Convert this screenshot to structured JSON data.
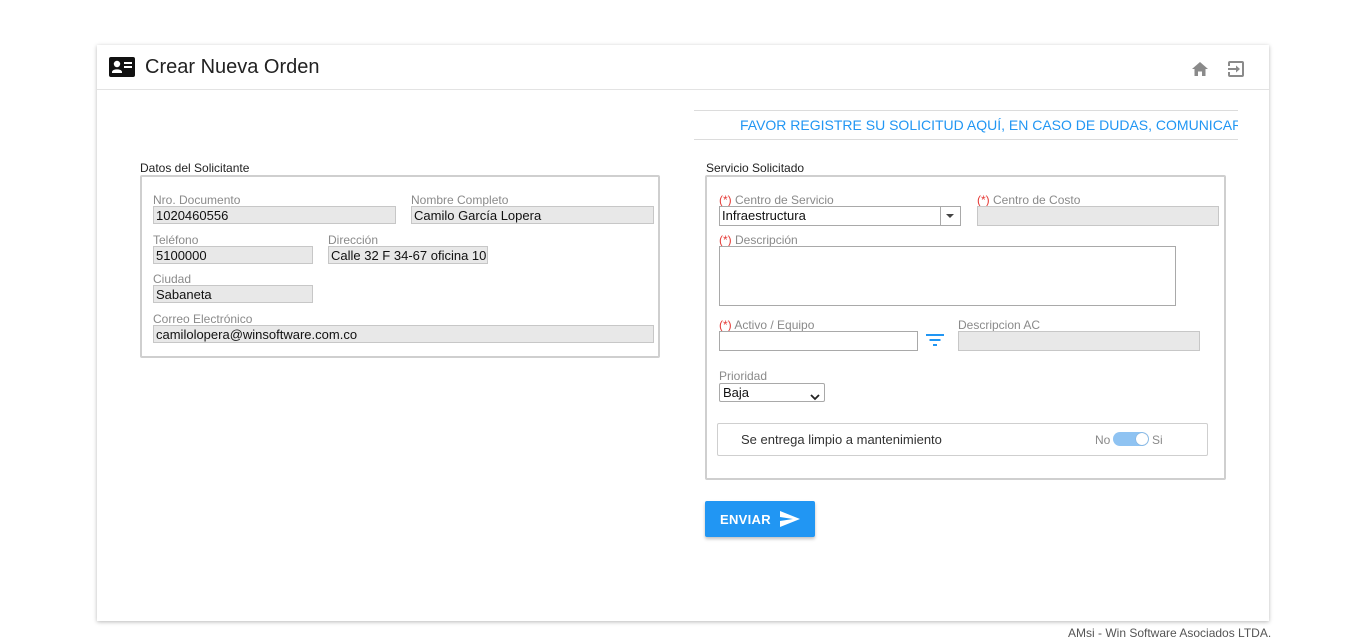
{
  "header": {
    "title": "Crear Nueva Orden",
    "title_icon": "contact-card-icon",
    "home_icon": "home-icon",
    "exit_icon": "exit-icon"
  },
  "notice": {
    "text": "FAVOR REGISTRE SU SOLICITUD AQUÍ, EN CASO DE DUDAS, COMUNICARSE CON"
  },
  "solicitante": {
    "section_title": "Datos del Solicitante",
    "documento_label": "Nro. Documento",
    "documento_value": "1020460556",
    "nombre_label": "Nombre Completo",
    "nombre_value": "Camilo García Lopera",
    "telefono_label": "Teléfono",
    "telefono_value": "5100000",
    "direccion_label": "Dirección",
    "direccion_value": "Calle 32 F 34-67 oficina 10",
    "ciudad_label": "Ciudad",
    "ciudad_value": "Sabaneta",
    "correo_label": "Correo Electrónico",
    "correo_value": "camilolopera@winsoftware.com.co"
  },
  "servicio": {
    "section_title": "Servicio Solicitado",
    "required_mark": "(*)",
    "centro_servicio_label": "Centro de Servicio",
    "centro_servicio_value": "Infraestructura",
    "centro_costo_label": "Centro de Costo",
    "centro_costo_value": "",
    "descripcion_label": "Descripción",
    "descripcion_value": "",
    "activo_label": "Activo / Equipo",
    "activo_value": "",
    "descripcion_ac_label": "Descripcion AC",
    "descripcion_ac_value": "",
    "prioridad_label": "Prioridad",
    "prioridad_value": "Baja",
    "limpio_label": "Se entrega limpio a mantenimiento",
    "toggle_no": "No",
    "toggle_si": "Si",
    "toggle_on": true
  },
  "actions": {
    "send_label": "ENVIAR"
  },
  "footer": {
    "text": "AMsi - Win Software Asociados LTDA."
  },
  "colors": {
    "accent": "#2196f3",
    "required": "#e53935",
    "readonly_bg": "#e8e8e8"
  }
}
